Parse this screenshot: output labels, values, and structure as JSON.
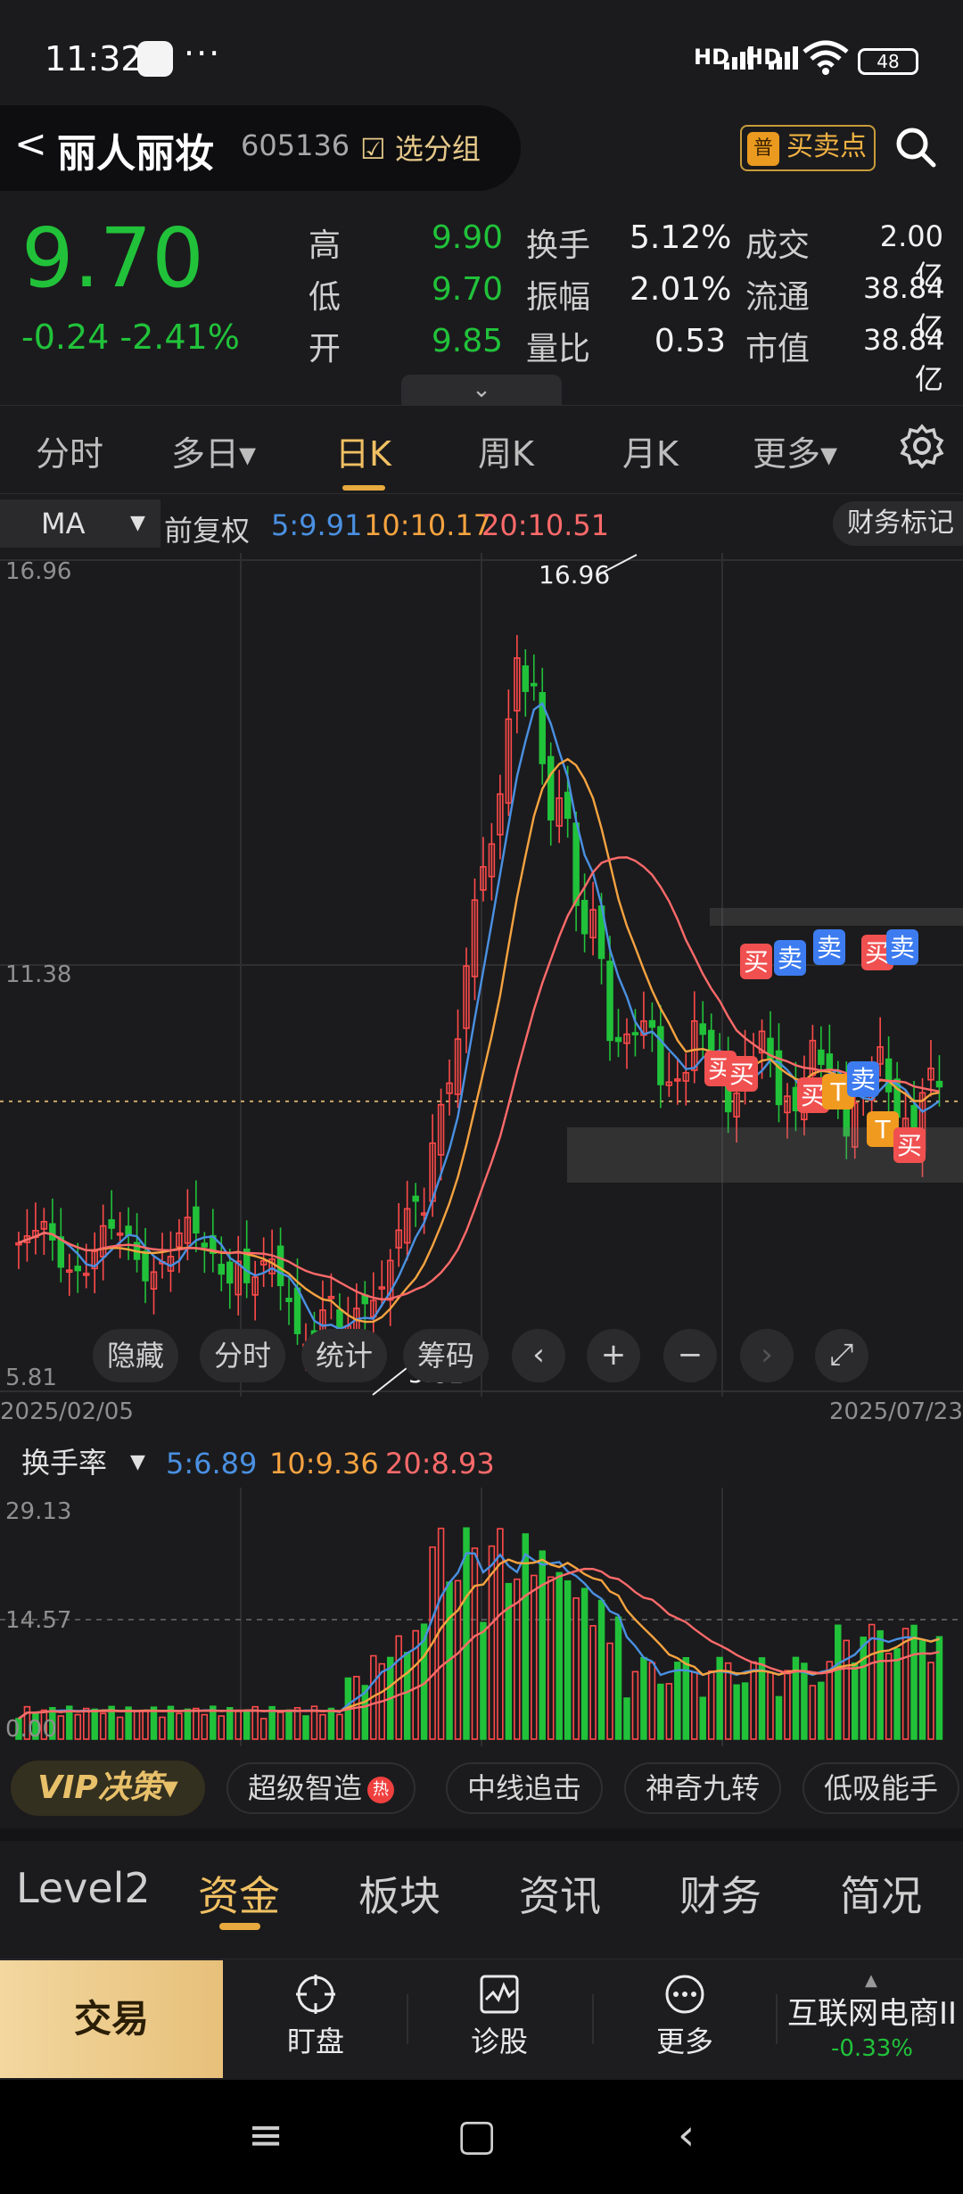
{
  "status": {
    "time": "11:32",
    "more": "···",
    "sig1": "HD",
    "sig2": "HD",
    "battery": "48"
  },
  "header": {
    "back_glyph": "<",
    "stock_name": "丽人丽妆",
    "stock_code": "605136",
    "group_label": "☑ 选分组",
    "buy_sell_label": "买卖点",
    "buy_sell_badge": "普",
    "icons": [
      "back-icon",
      "search-icon"
    ]
  },
  "quote": {
    "price": "9.70",
    "change": "-0.24 -2.41%",
    "stats": [
      {
        "label": "高",
        "value": "9.90",
        "color": "green"
      },
      {
        "label": "换手",
        "value": "5.12%",
        "color": "white"
      },
      {
        "label": "成交",
        "value": "2.00亿",
        "color": "white"
      },
      {
        "label": "低",
        "value": "9.70",
        "color": "green"
      },
      {
        "label": "振幅",
        "value": "2.01%",
        "color": "white"
      },
      {
        "label": "流通",
        "value": "38.84亿",
        "color": "white"
      },
      {
        "label": "开",
        "value": "9.85",
        "color": "green"
      },
      {
        "label": "量比",
        "value": "0.53",
        "color": "white"
      },
      {
        "label": "市值",
        "value": "38.84亿",
        "color": "white"
      }
    ],
    "expand_glyph": "⌄"
  },
  "period_tabs": [
    {
      "label": "分时"
    },
    {
      "label": "多日▾"
    },
    {
      "label": "日K",
      "active": true
    },
    {
      "label": "周K"
    },
    {
      "label": "月K"
    },
    {
      "label": "更多▾"
    }
  ],
  "ma_row": {
    "selector": "MA",
    "adjust": "前复权",
    "ma5": "5:9.91",
    "ma10": "10:10.17",
    "ma20": "20:10.51",
    "finance_mark": "财务标记"
  },
  "kline": {
    "y_top": "16.96",
    "y_mid": "11.38",
    "y_bottom": "5.81",
    "max_label": "16.96",
    "min_label": "5.81",
    "date_start": "2025/02/05",
    "date_end": "2025/07/23",
    "controls": [
      "隐藏",
      "分时",
      "统计",
      "筹码"
    ],
    "round_controls": [
      "‹",
      "+",
      "−",
      "›",
      "⤢"
    ]
  },
  "chart_data": [
    {
      "type": "candlestick",
      "title": "",
      "ylim": [
        5.81,
        16.96
      ],
      "y_ticks": [
        16.96,
        11.38,
        5.81
      ],
      "last_close": 9.7,
      "x_start": "2025/02/05",
      "x_end": "2025/07/23",
      "series": [
        {
          "name": "5",
          "value_label": "9.91",
          "color": "#4a90e2"
        },
        {
          "name": "10",
          "value_label": "10.17",
          "color": "#f6a340"
        },
        {
          "name": "20",
          "value_label": "10.51",
          "color": "#ff6a6a"
        }
      ],
      "annotations": [
        "买",
        "卖",
        "T"
      ]
    },
    {
      "type": "bar",
      "title": "换手率",
      "ylim": [
        0,
        29.13
      ],
      "y_ticks": [
        29.13,
        14.57,
        0.0
      ],
      "series": [
        {
          "name": "5",
          "value_label": "6.89",
          "color": "#4a90e2"
        },
        {
          "name": "10",
          "value_label": "9.36",
          "color": "#f6a340"
        },
        {
          "name": "20",
          "value_label": "8.93",
          "color": "#ff6a6a"
        }
      ]
    }
  ],
  "volume": {
    "selector": "换手率",
    "ma5": "5:6.89",
    "ma10": "10:9.36",
    "ma20": "20:8.93",
    "y_top": "29.13",
    "y_mid": "14.57",
    "y_bottom": "0.00"
  },
  "vip_bar": {
    "vip": "VIP决策▾",
    "chips": [
      "超级智造",
      "中线追击",
      "神奇九转",
      "低吸能手"
    ],
    "hot": "热"
  },
  "bottom_tabs": [
    {
      "label": "Level2"
    },
    {
      "label": "资金",
      "active": true
    },
    {
      "label": "板块"
    },
    {
      "label": "资讯"
    },
    {
      "label": "财务"
    },
    {
      "label": "简况"
    }
  ],
  "actions": {
    "trade": "交易",
    "watch": "盯盘",
    "diagnose": "诊股",
    "more": "更多",
    "industry": "互联网电商II",
    "industry_change": "-0.33%",
    "icons": [
      "crosshair-icon",
      "chart-icon",
      "more-dots-icon"
    ]
  },
  "navbar": {
    "menu": "≡",
    "home": "▢",
    "back": "‹"
  },
  "colors": {
    "up": "#ff4a4a",
    "down": "#21c23a",
    "accent": "#f0c063",
    "ma5": "#4a90e2",
    "ma10": "#f6a340",
    "ma20": "#ff6a6a"
  }
}
